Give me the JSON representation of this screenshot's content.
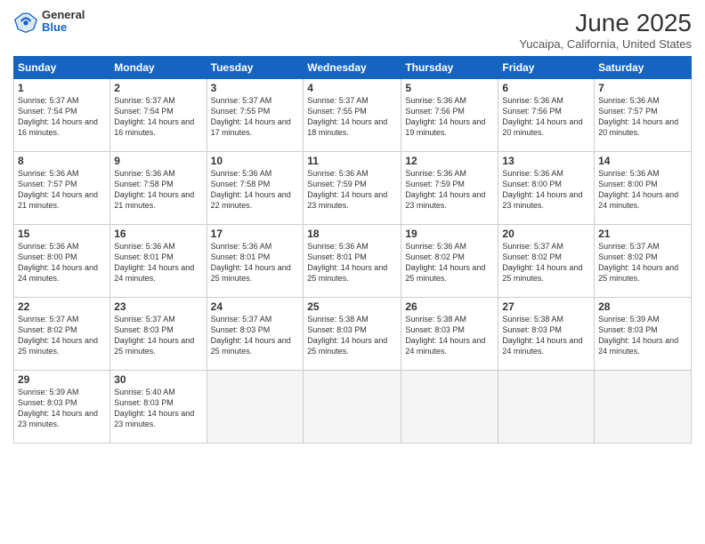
{
  "header": {
    "logo_general": "General",
    "logo_blue": "Blue",
    "month_title": "June 2025",
    "location": "Yucaipa, California, United States"
  },
  "calendar": {
    "days_of_week": [
      "Sunday",
      "Monday",
      "Tuesday",
      "Wednesday",
      "Thursday",
      "Friday",
      "Saturday"
    ],
    "weeks": [
      [
        {
          "day": "",
          "info": ""
        },
        {
          "day": "2",
          "info": "Sunrise: 5:37 AM\nSunset: 7:54 PM\nDaylight: 14 hours and 16 minutes."
        },
        {
          "day": "3",
          "info": "Sunrise: 5:37 AM\nSunset: 7:55 PM\nDaylight: 14 hours and 17 minutes."
        },
        {
          "day": "4",
          "info": "Sunrise: 5:37 AM\nSunset: 7:55 PM\nDaylight: 14 hours and 18 minutes."
        },
        {
          "day": "5",
          "info": "Sunrise: 5:36 AM\nSunset: 7:56 PM\nDaylight: 14 hours and 19 minutes."
        },
        {
          "day": "6",
          "info": "Sunrise: 5:36 AM\nSunset: 7:56 PM\nDaylight: 14 hours and 20 minutes."
        },
        {
          "day": "7",
          "info": "Sunrise: 5:36 AM\nSunset: 7:57 PM\nDaylight: 14 hours and 20 minutes."
        }
      ],
      [
        {
          "day": "8",
          "info": "Sunrise: 5:36 AM\nSunset: 7:57 PM\nDaylight: 14 hours and 21 minutes."
        },
        {
          "day": "9",
          "info": "Sunrise: 5:36 AM\nSunset: 7:58 PM\nDaylight: 14 hours and 21 minutes."
        },
        {
          "day": "10",
          "info": "Sunrise: 5:36 AM\nSunset: 7:58 PM\nDaylight: 14 hours and 22 minutes."
        },
        {
          "day": "11",
          "info": "Sunrise: 5:36 AM\nSunset: 7:59 PM\nDaylight: 14 hours and 23 minutes."
        },
        {
          "day": "12",
          "info": "Sunrise: 5:36 AM\nSunset: 7:59 PM\nDaylight: 14 hours and 23 minutes."
        },
        {
          "day": "13",
          "info": "Sunrise: 5:36 AM\nSunset: 8:00 PM\nDaylight: 14 hours and 23 minutes."
        },
        {
          "day": "14",
          "info": "Sunrise: 5:36 AM\nSunset: 8:00 PM\nDaylight: 14 hours and 24 minutes."
        }
      ],
      [
        {
          "day": "15",
          "info": "Sunrise: 5:36 AM\nSunset: 8:00 PM\nDaylight: 14 hours and 24 minutes."
        },
        {
          "day": "16",
          "info": "Sunrise: 5:36 AM\nSunset: 8:01 PM\nDaylight: 14 hours and 24 minutes."
        },
        {
          "day": "17",
          "info": "Sunrise: 5:36 AM\nSunset: 8:01 PM\nDaylight: 14 hours and 25 minutes."
        },
        {
          "day": "18",
          "info": "Sunrise: 5:36 AM\nSunset: 8:01 PM\nDaylight: 14 hours and 25 minutes."
        },
        {
          "day": "19",
          "info": "Sunrise: 5:36 AM\nSunset: 8:02 PM\nDaylight: 14 hours and 25 minutes."
        },
        {
          "day": "20",
          "info": "Sunrise: 5:37 AM\nSunset: 8:02 PM\nDaylight: 14 hours and 25 minutes."
        },
        {
          "day": "21",
          "info": "Sunrise: 5:37 AM\nSunset: 8:02 PM\nDaylight: 14 hours and 25 minutes."
        }
      ],
      [
        {
          "day": "22",
          "info": "Sunrise: 5:37 AM\nSunset: 8:02 PM\nDaylight: 14 hours and 25 minutes."
        },
        {
          "day": "23",
          "info": "Sunrise: 5:37 AM\nSunset: 8:03 PM\nDaylight: 14 hours and 25 minutes."
        },
        {
          "day": "24",
          "info": "Sunrise: 5:37 AM\nSunset: 8:03 PM\nDaylight: 14 hours and 25 minutes."
        },
        {
          "day": "25",
          "info": "Sunrise: 5:38 AM\nSunset: 8:03 PM\nDaylight: 14 hours and 25 minutes."
        },
        {
          "day": "26",
          "info": "Sunrise: 5:38 AM\nSunset: 8:03 PM\nDaylight: 14 hours and 24 minutes."
        },
        {
          "day": "27",
          "info": "Sunrise: 5:38 AM\nSunset: 8:03 PM\nDaylight: 14 hours and 24 minutes."
        },
        {
          "day": "28",
          "info": "Sunrise: 5:39 AM\nSunset: 8:03 PM\nDaylight: 14 hours and 24 minutes."
        }
      ],
      [
        {
          "day": "29",
          "info": "Sunrise: 5:39 AM\nSunset: 8:03 PM\nDaylight: 14 hours and 23 minutes."
        },
        {
          "day": "30",
          "info": "Sunrise: 5:40 AM\nSunset: 8:03 PM\nDaylight: 14 hours and 23 minutes."
        },
        {
          "day": "",
          "info": ""
        },
        {
          "day": "",
          "info": ""
        },
        {
          "day": "",
          "info": ""
        },
        {
          "day": "",
          "info": ""
        },
        {
          "day": "",
          "info": ""
        }
      ]
    ],
    "week0_sun": {
      "day": "1",
      "info": "Sunrise: 5:37 AM\nSunset: 7:54 PM\nDaylight: 14 hours and 16 minutes."
    }
  }
}
